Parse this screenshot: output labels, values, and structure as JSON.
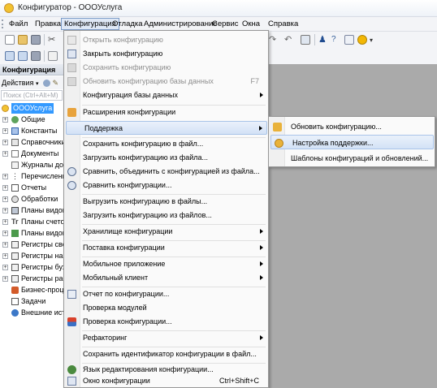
{
  "window": {
    "title": "Конфигуратор - ОООУслуга"
  },
  "menubar": {
    "items": [
      "Файл",
      "Правка",
      "Конфигурация",
      "Отладка",
      "Администрирование",
      "Сервис",
      "Окна",
      "Справка"
    ],
    "active": "Конфигурация"
  },
  "left_panel": {
    "title": "Конфигурация",
    "actions_label": "Действия",
    "search_placeholder": "Поиск (Ctrl+Alt+M)",
    "tree": [
      "ОООУслуга",
      "Общие",
      "Константы",
      "Справочники",
      "Документы",
      "Журналы документов",
      "Перечисления",
      "Отчеты",
      "Обработки",
      "Планы видов характеристик",
      "Планы счетов",
      "Планы видов расчета",
      "Регистры сведений",
      "Регистры накопления",
      "Регистры бухгалтерии",
      "Регистры расчета",
      "Бизнес-процессы",
      "Задачи",
      "Внешние источники данных"
    ]
  },
  "config_menu": {
    "items": [
      {
        "label": "Открыть конфигурацию",
        "enabled": false
      },
      {
        "label": "Закрыть конфигурацию",
        "enabled": true
      },
      {
        "label": "Сохранить конфигурацию",
        "enabled": false
      },
      {
        "label": "Обновить конфигурацию базы данных",
        "shortcut": "F7",
        "enabled": false
      },
      {
        "label": "Конфигурация базы данных",
        "enabled": true,
        "submenu": true
      },
      {
        "label": "Расширения конфигурации",
        "enabled": true
      },
      {
        "label": "Поддержка",
        "enabled": true,
        "submenu": true,
        "highlighted": true
      },
      {
        "label": "Сохранить конфигурацию в файл...",
        "enabled": true
      },
      {
        "label": "Загрузить конфигурацию из файла...",
        "enabled": true
      },
      {
        "label": "Сравнить, объединить с конфигурацией из файла...",
        "enabled": true
      },
      {
        "label": "Сравнить конфигурации...",
        "enabled": true
      },
      {
        "label": "Выгрузить конфигурацию в файлы...",
        "enabled": true
      },
      {
        "label": "Загрузить конфигурацию из файлов...",
        "enabled": true
      },
      {
        "label": "Хранилище конфигурации",
        "enabled": true,
        "submenu": true
      },
      {
        "label": "Поставка конфигурации",
        "enabled": true,
        "submenu": true
      },
      {
        "label": "Мобильное приложение",
        "enabled": true,
        "submenu": true
      },
      {
        "label": "Мобильный клиент",
        "enabled": true,
        "submenu": true
      },
      {
        "label": "Отчет по конфигурации...",
        "enabled": true
      },
      {
        "label": "Проверка модулей",
        "enabled": true
      },
      {
        "label": "Проверка конфигурации...",
        "enabled": true
      },
      {
        "label": "Рефакторинг",
        "enabled": true,
        "submenu": true
      },
      {
        "label": "Сохранить идентификатор конфигурации в файл...",
        "enabled": true
      },
      {
        "label": "Язык редактирования конфигурации...",
        "enabled": true
      },
      {
        "label": "Окно конфигурации",
        "shortcut": "Ctrl+Shift+C",
        "enabled": true
      }
    ]
  },
  "support_submenu": {
    "items": [
      {
        "label": "Обновить конфигурацию..."
      },
      {
        "label": "Настройка поддержки...",
        "highlighted": true
      },
      {
        "label": "Шаблоны конфигураций и обновлений..."
      }
    ]
  },
  "colors": {
    "selection": "#3399ff",
    "workspace": "#aaaaaa",
    "menu_highlight": "#d3e2f6"
  }
}
